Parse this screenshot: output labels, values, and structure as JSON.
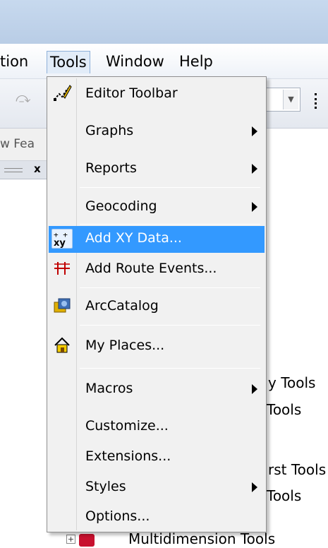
{
  "menubar": {
    "items": [
      {
        "label": "tion"
      },
      {
        "label": "Tools"
      },
      {
        "label": "Window"
      },
      {
        "label": "Help"
      }
    ]
  },
  "toolbar": {
    "redo_glyph": "⤼"
  },
  "left_pane": {
    "text": "w Fea",
    "close": "x"
  },
  "tools_menu": {
    "items": [
      {
        "label": "Editor Toolbar",
        "icon": "editor-toolbar-icon"
      },
      {
        "label": "Graphs",
        "submenu": true
      },
      {
        "label": "Reports",
        "submenu": true
      },
      {
        "label": "Geocoding",
        "submenu": true
      },
      {
        "label": "Add XY Data...",
        "icon": "add-xy-data-icon",
        "highlighted": true
      },
      {
        "label": "Add Route Events...",
        "icon": "add-route-events-icon"
      },
      {
        "label": "ArcCatalog",
        "icon": "arccatalog-icon"
      },
      {
        "label": "My Places...",
        "icon": "my-places-icon"
      },
      {
        "label": "Macros",
        "submenu": true
      },
      {
        "label": "Customize..."
      },
      {
        "label": "Extensions..."
      },
      {
        "label": "Styles",
        "submenu": true
      },
      {
        "label": "Options..."
      }
    ]
  },
  "background": {
    "text_1": "y Tools",
    "text_2": "Tools",
    "text_3": "rst Tools",
    "text_4": "Tools",
    "tree_label": "Multidimension Tools",
    "tree_expander": "+"
  },
  "colors": {
    "highlight": "#3399ff",
    "menu_bg": "#f1f1f1"
  }
}
